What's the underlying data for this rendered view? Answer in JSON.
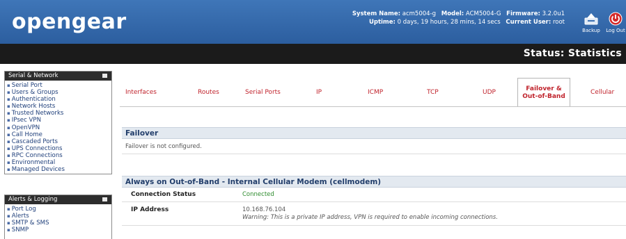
{
  "header": {
    "logo": "opengear",
    "system_name_label": "System Name:",
    "system_name": "acm5004-g",
    "model_label": "Model:",
    "model": "ACM5004-G",
    "firmware_label": "Firmware:",
    "firmware": "3.2.0u1",
    "uptime_label": "Uptime:",
    "uptime": "0 days, 19 hours, 28 mins, 14 secs",
    "current_user_label": "Current User:",
    "current_user": "root",
    "backup_label": "Backup",
    "logout_label": "Log Out"
  },
  "page_title": "Status: Statistics",
  "sidebar": {
    "serial_network": {
      "title": "Serial & Network",
      "items": [
        "Serial Port",
        "Users & Groups",
        "Authentication",
        "Network Hosts",
        "Trusted Networks",
        "IPsec VPN",
        "OpenVPN",
        "Call Home",
        "Cascaded Ports",
        "UPS Connections",
        "RPC Connections",
        "Environmental",
        "Managed Devices"
      ]
    },
    "alerts_logging": {
      "title": "Alerts & Logging",
      "items": [
        "Port Log",
        "Alerts",
        "SMTP & SMS",
        "SNMP"
      ]
    }
  },
  "tabs": [
    {
      "label": "Interfaces"
    },
    {
      "label": "Routes"
    },
    {
      "label": "Serial Ports"
    },
    {
      "label": "IP"
    },
    {
      "label": "ICMP"
    },
    {
      "label": "TCP"
    },
    {
      "label": "UDP"
    },
    {
      "label_line1": "Failover &",
      "label_line2": "Out-of-Band",
      "active": true
    },
    {
      "label": "Cellular"
    }
  ],
  "failover": {
    "title": "Failover",
    "message": "Failover is not configured."
  },
  "oob": {
    "title": "Always on Out-of-Band - Internal Cellular Modem (cellmodem)",
    "connection_status_label": "Connection Status",
    "connection_status_value": "Connected",
    "ip_address_label": "IP Address",
    "ip_address_value": "10.168.76.104",
    "ip_warning": "Warning: This is a private IP address, VPN is required to enable incoming connections."
  },
  "colors": {
    "header_blue": "#3a70b2",
    "title_bar": "#1b1b1b",
    "tab_red": "#c0232c",
    "connected_green": "#2e8b2e",
    "section_bg": "#e3e9f0"
  },
  "icons": {
    "backup": "backup-tray-icon",
    "logout": "power-icon",
    "collapse": "collapse-square-icon",
    "bullet": "bullet-icon"
  }
}
